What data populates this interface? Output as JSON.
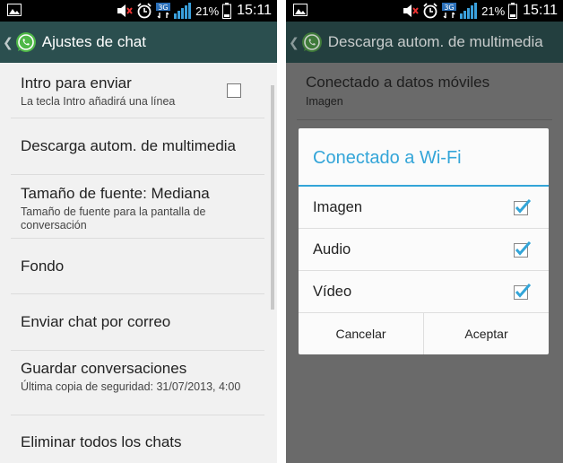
{
  "status_bar": {
    "battery_pct": "21%",
    "time": "15:11",
    "network": "3G",
    "icons": [
      "gallery-icon",
      "volume-muted-icon",
      "alarm-icon",
      "network-3g-icon",
      "signal-icon",
      "battery-icon"
    ]
  },
  "left": {
    "header_title": "Ajustes de chat",
    "items": [
      {
        "title": "Intro para enviar",
        "subtitle": "La tecla Intro añadirá una línea",
        "checked": false
      },
      {
        "title": "Descarga autom. de multimedia"
      },
      {
        "title": "Tamaño de fuente: Mediana",
        "subtitle": "Tamaño de fuente para la pantalla de conversación"
      },
      {
        "title": "Fondo"
      },
      {
        "title": "Enviar chat por correo"
      },
      {
        "title": "Guardar conversaciones",
        "subtitle": "Última copia de seguridad: 31/07/2013, 4:00"
      },
      {
        "title": "Eliminar todos los chats"
      }
    ]
  },
  "right": {
    "header_title": "Descarga autom. de multimedia",
    "background_item": {
      "title": "Conectado a datos móviles",
      "subtitle": "Imagen"
    },
    "dialog": {
      "title": "Conectado a Wi-Fi",
      "options": [
        {
          "label": "Imagen",
          "checked": true
        },
        {
          "label": "Audio",
          "checked": true
        },
        {
          "label": "Vídeo",
          "checked": true
        }
      ],
      "cancel_label": "Cancelar",
      "accept_label": "Aceptar"
    }
  },
  "colors": {
    "action_bar": "#2b4f4f",
    "accent_blue": "#33a5d8",
    "whatsapp_green": "#4fb848",
    "dim_overlay": "#6a6a6a"
  }
}
